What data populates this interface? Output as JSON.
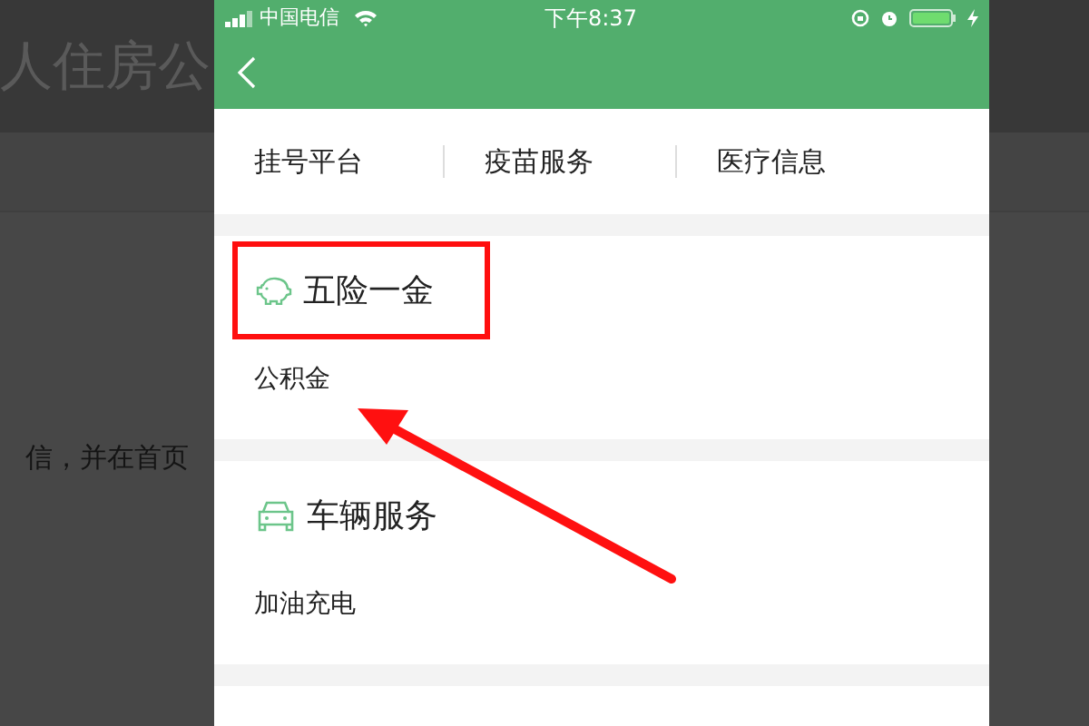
{
  "background": {
    "title": "人住房公",
    "text": "信，并在首页"
  },
  "status_bar": {
    "carrier": "中国电信",
    "time": "下午8:37"
  },
  "quick_links": [
    {
      "label": "挂号平台"
    },
    {
      "label": "疫苗服务"
    },
    {
      "label": "医疗信息"
    }
  ],
  "sections": [
    {
      "title": "五险一金",
      "highlighted": true,
      "items": [
        {
          "label": "公积金",
          "pointed": true
        }
      ]
    },
    {
      "title": "车辆服务",
      "highlighted": false,
      "items": [
        {
          "label": "加油充电",
          "pointed": false
        }
      ]
    }
  ]
}
